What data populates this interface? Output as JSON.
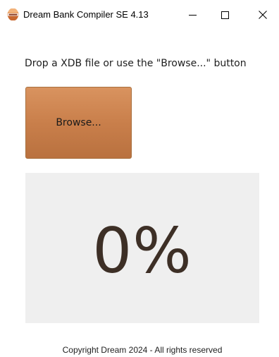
{
  "window": {
    "title": "Dream Bank Compiler SE 4.13",
    "icon": "app-logo-icon",
    "controls": {
      "minimize_icon": "minimize-icon",
      "maximize_icon": "maximize-icon",
      "close_icon": "close-icon"
    }
  },
  "main": {
    "instruction": "Drop a XDB file or use the \"Browse...\" button",
    "browse_label": "Browse...",
    "progress_text": "0%",
    "progress_value": 0
  },
  "footer": {
    "copyright": "Copyright Dream 2024 - All rights reserved"
  },
  "colors": {
    "button_accent": "#c97f4b",
    "progress_background": "#efefef",
    "progress_text": "#3d2f26"
  }
}
